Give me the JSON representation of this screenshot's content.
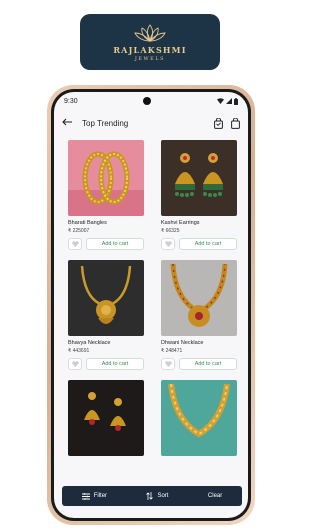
{
  "brand": {
    "name": "RAJLAKSHMI",
    "tagline": "JEWELS"
  },
  "status_bar": {
    "time": "9:30"
  },
  "header": {
    "title": "Top Trending"
  },
  "products": [
    {
      "name": "Bharati Bangles",
      "price": "₹ 225007",
      "cart_label": "Add to cart"
    },
    {
      "name": "Kashvi Earrings",
      "price": "₹ 66325",
      "cart_label": "Add to cart"
    },
    {
      "name": "Bhavya Necklace",
      "price": "₹ 443691",
      "cart_label": "Add to cart"
    },
    {
      "name": "Dhwani Necklace",
      "price": "₹ 248471",
      "cart_label": "Add to cart"
    },
    {
      "name": "",
      "price": "",
      "cart_label": ""
    },
    {
      "name": "",
      "price": "",
      "cart_label": ""
    }
  ],
  "bottom_bar": {
    "filter_label": "Filter",
    "sort_label": "Sort",
    "clear_label": "Clear"
  },
  "colors": {
    "brand_navy": "#1d3346",
    "gold": "#e6c98f",
    "cart_green": "#3a8a5a",
    "bottom_bar": "#1d2b3d"
  }
}
